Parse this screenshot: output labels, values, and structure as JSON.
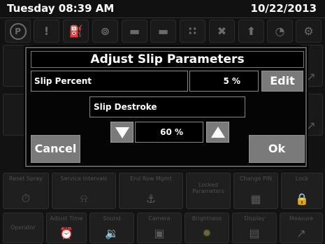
{
  "status": {
    "day_time": "Tuesday 08:39 AM",
    "date": "10/22/2013"
  },
  "warnings": [
    {
      "icon": "parking-icon",
      "glyph": "P"
    },
    {
      "icon": "warning-icon",
      "glyph": "!"
    },
    {
      "icon": "fuel-icon",
      "glyph": "⛽"
    },
    {
      "icon": "engine-icon",
      "glyph": "⊚"
    },
    {
      "icon": "pump-icon",
      "glyph": "▬"
    },
    {
      "icon": "pump-icon",
      "glyph": "▬"
    },
    {
      "icon": "hydraulic-icon",
      "glyph": "∷"
    },
    {
      "icon": "filter-icon",
      "glyph": "✖"
    },
    {
      "icon": "level-icon",
      "glyph": "⬆"
    },
    {
      "icon": "tank-icon",
      "glyph": "◔"
    },
    {
      "icon": "gear-icon",
      "glyph": "⚙"
    }
  ],
  "background_tiles": {
    "row1": [
      {
        "label": "Reset Spray",
        "icon": "stopwatch-icon",
        "glyph": "⏱"
      },
      {
        "label": "Service Intervals",
        "icon": "bell-icon",
        "glyph": "⍾"
      },
      {
        "label": "End Row Mgmt",
        "icon": "joystick-icon",
        "glyph": "⚓"
      },
      {
        "label": "Locked Parameters",
        "icon": "lock-icon",
        "glyph": ""
      },
      {
        "label": "Change PIN",
        "icon": "keypad-icon",
        "glyph": "▦"
      },
      {
        "label": "Lock",
        "icon": "padlock-icon",
        "glyph": "🔒"
      }
    ],
    "row2": [
      {
        "label": "Operator",
        "icon": "person-icon",
        "glyph": ""
      },
      {
        "label": "Adjust Time",
        "icon": "clock-icon",
        "glyph": "⏰"
      },
      {
        "label": "Sound",
        "icon": "speaker-icon",
        "glyph": "🔉"
      },
      {
        "label": "Camera",
        "icon": "camera-icon",
        "glyph": "▣"
      },
      {
        "label": "Brightness",
        "icon": "sun-icon",
        "glyph": "✹"
      },
      {
        "label": "Display",
        "icon": "display-icon",
        "glyph": "▤"
      },
      {
        "label": "Measure",
        "icon": "graph-icon",
        "glyph": "↗"
      }
    ]
  },
  "dialog": {
    "title": "Adjust Slip Parameters",
    "slip_percent_label": "Slip Percent",
    "slip_percent_value": "5 %",
    "edit_label": "Edit",
    "slip_destroke_label": "Slip Destroke",
    "slip_destroke_value": "60 %",
    "cancel_label": "Cancel",
    "ok_label": "Ok"
  },
  "colors": {
    "button": "#7a7a7a",
    "background": "#121212",
    "dialog": "#050505"
  }
}
